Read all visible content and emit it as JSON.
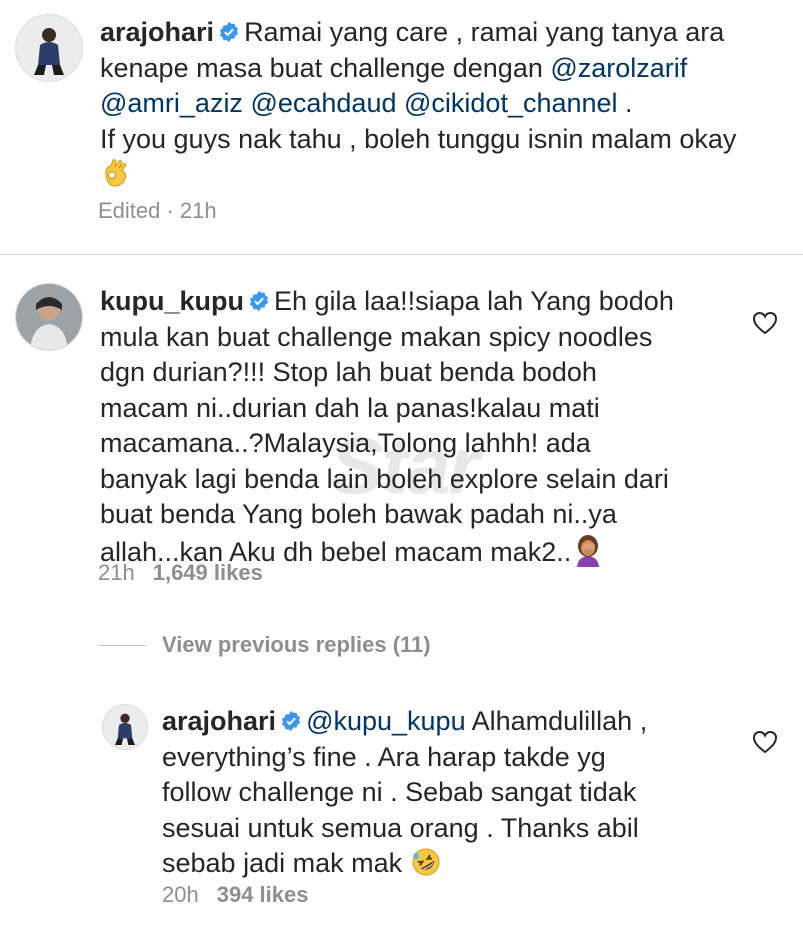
{
  "watermark": "Star",
  "comments": [
    {
      "username": "arajohari",
      "text_parts": [
        "Ramai yang care , ramai yang tanya ara",
        "kenape masa buat challenge dengan ",
        "@zarolzarif",
        "@amri_aziz",
        "@ecahdaud",
        "@cikidot_channel",
        " .",
        "If you guys nak tahu , boleh tunggu isnin malam okay"
      ],
      "meta_edited": "Edited · 21h",
      "emoji": "ok-hand-emoji"
    },
    {
      "username": "kupu_kupu",
      "lines": [
        "Eh gila laa!!siapa lah Yang bodoh",
        "mula kan buat challenge makan spicy noodles",
        "dgn durian?!!! Stop lah buat benda bodoh",
        "macam ni..durian dah la panas!kalau mati",
        "macamana..?Malaysia,Tolong lahhh! ada",
        "banyak lagi benda lain boleh explore selain dari",
        "buat benda Yang boleh bawak padah ni..ya",
        "allah...kan Aku dh bebel macam mak2.."
      ],
      "time": "21h",
      "likes": "1,649 likes",
      "emoji": "facepalm-emoji"
    },
    {
      "view_replies": "View previous replies (11)"
    },
    {
      "username": "arajohari",
      "mention": "@kupu_kupu",
      "lines": [
        " Alhamdulillah ,",
        "everything’s fine . Ara harap takde yg",
        "follow challenge ni . Sebab sangat tidak",
        "sesuai untuk semua orang . Thanks abil",
        "sebab jadi mak mak "
      ],
      "time": "20h",
      "likes": "394 likes",
      "emoji": "rofl-emoji"
    }
  ],
  "colors": {
    "text": "#262626",
    "meta": "#8e8e8e",
    "mention": "#003569",
    "verified": "#3897f0",
    "divider": "#dbdbdb"
  }
}
